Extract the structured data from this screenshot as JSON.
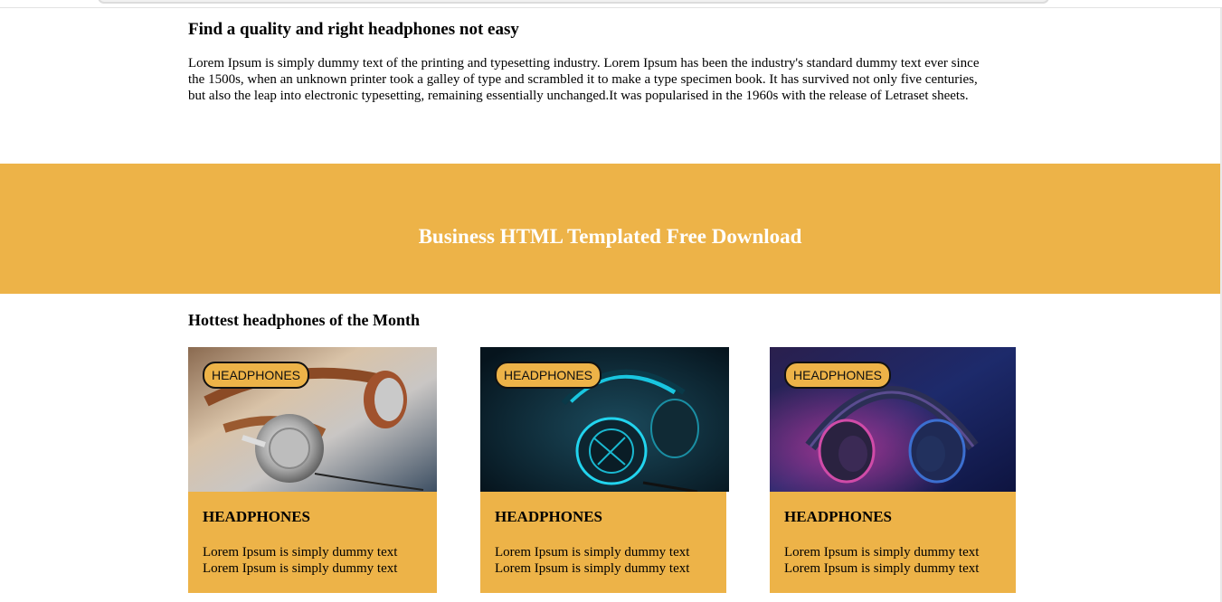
{
  "intro": {
    "title": "Find a quality and right headphones not easy",
    "paragraph": "Lorem Ipsum is simply dummy text of the printing and typesetting industry. Lorem Ipsum has been the industry's standard dummy text ever since the 1500s, when an unknown printer took a galley of type and scrambled it to make a type specimen book. It has survived not only five centuries, but also the leap into electronic typesetting, remaining essentially unchanged.It was popularised in the 1960s with the release of Letraset sheets."
  },
  "banner": {
    "title": "Business HTML Templated Free Download"
  },
  "hottest": {
    "title": "Hottest headphones of the Month",
    "cards": [
      {
        "badge": "HEADPHONES",
        "title": "HEADPHONES",
        "line1": "Lorem Ipsum is simply dummy text",
        "line2": "Lorem Ipsum is simply dummy text"
      },
      {
        "badge": "HEADPHONES",
        "title": "HEADPHONES",
        "line1": "Lorem Ipsum is simply dummy text",
        "line2": "Lorem Ipsum is simply dummy text"
      },
      {
        "badge": "HEADPHONES",
        "title": "HEADPHONES",
        "line1": "Lorem Ipsum is simply dummy text",
        "line2": "Lorem Ipsum is simply dummy text"
      }
    ]
  },
  "colors": {
    "accent": "#edb348",
    "banner_text": "#ffffff"
  }
}
